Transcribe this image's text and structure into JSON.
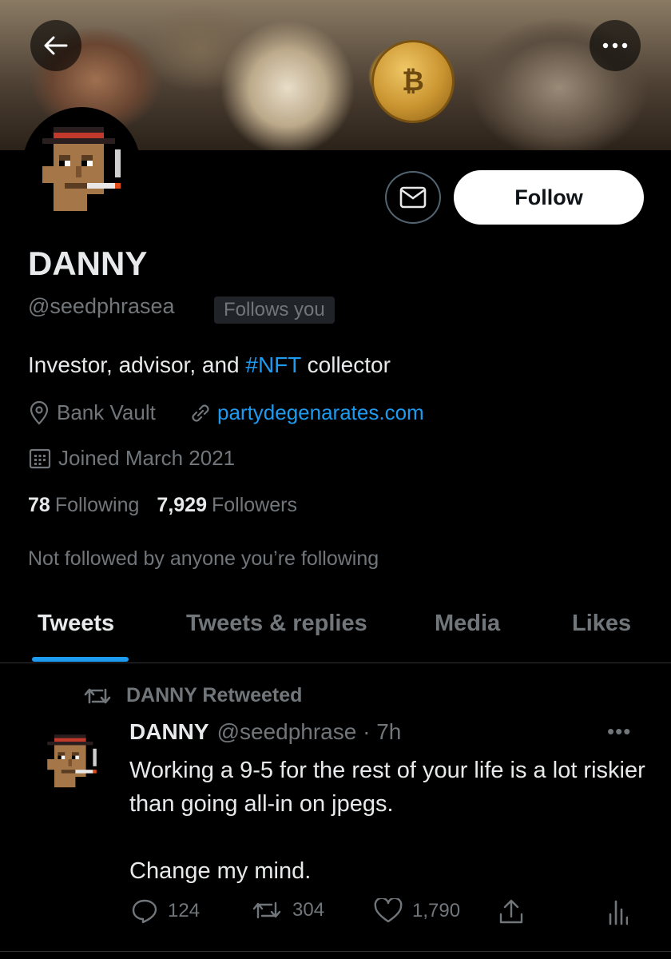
{
  "colors": {
    "background": "#000000",
    "primary_text": "#e7e9ea",
    "secondary_text": "#71767b",
    "accent": "#1d9bf0",
    "follow_button_bg": "#ffffff"
  },
  "header": {
    "back_icon": "arrow-left-icon",
    "more_icon": "more-horizontal-icon",
    "banner_icon": "bitcoin-icon",
    "banner_symbol": "₿"
  },
  "profile": {
    "name": "DANNY",
    "handle": "@seedphrasea",
    "follows_you": "Follows you",
    "message_icon": "envelope-icon",
    "follow_label": "Follow",
    "bio_prefix": "Investor, advisor, and ",
    "bio_hashtag": "#NFT",
    "bio_suffix": " collector",
    "location": "Bank Vault",
    "website": "partydegenarates.com",
    "joined": "Joined March 2021",
    "following_count": "78",
    "following_label": "Following",
    "followers_count": "7,929",
    "followers_label": "Followers",
    "not_followed": "Not followed by anyone you’re following"
  },
  "tabs": [
    {
      "label": "Tweets",
      "active": true
    },
    {
      "label": "Tweets & replies",
      "active": false
    },
    {
      "label": "Media",
      "active": false
    },
    {
      "label": "Likes",
      "active": false
    }
  ],
  "tweet": {
    "retweeted_by": "DANNY Retweeted",
    "author": "DANNY",
    "handle_time": "@seedphrase · 7h",
    "more": "•••",
    "text": "Working a 9-5 for the rest of your life is a lot riskier than going all-in on jpegs.\n\nChange my mind.",
    "replies": "124",
    "retweets": "304",
    "likes": "1,790",
    "icons": [
      "reply-icon",
      "retweet-icon",
      "like-icon",
      "share-icon",
      "analytics-icon"
    ]
  }
}
